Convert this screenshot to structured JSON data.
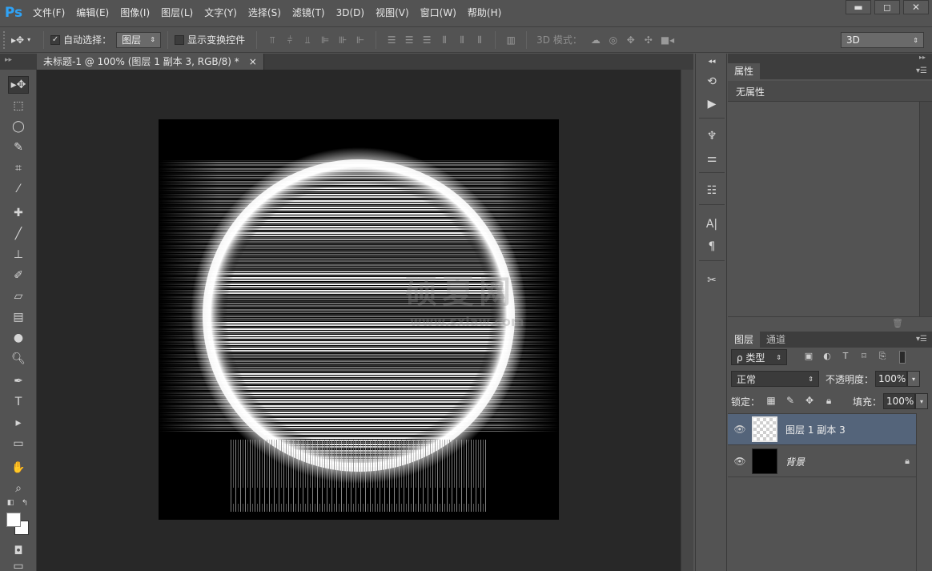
{
  "app": {
    "logo": "Ps"
  },
  "menu": [
    "文件(F)",
    "编辑(E)",
    "图像(I)",
    "图层(L)",
    "文字(Y)",
    "选择(S)",
    "滤镜(T)",
    "3D(D)",
    "视图(V)",
    "窗口(W)",
    "帮助(H)"
  ],
  "window_controls": {
    "minimize": "▬",
    "maximize": "◻",
    "close": "✕"
  },
  "options": {
    "tool_icon": "move-tool-icon",
    "auto_select_checked": true,
    "auto_select_label": "自动选择：",
    "auto_select_value": "图层",
    "show_transform_label": "显示变换控件",
    "show_transform_checked": false,
    "mode3d_label": "3D 模式：",
    "workspace": "3D"
  },
  "document": {
    "tab_title": "未标题-1 @ 100% (图层 1 副本 3, RGB/8) *",
    "tab_close": "×"
  },
  "watermark": {
    "text": "硕夏网",
    "sub": "www.sxiaw.com"
  },
  "properties": {
    "tab_label": "属性",
    "content": "无属性"
  },
  "layers_panel": {
    "tabs": [
      "图层",
      "通道"
    ],
    "filter_label": "ρ 类型",
    "blend_mode": "正常",
    "opacity_label": "不透明度：",
    "opacity_value": "100%",
    "lock_label": "锁定：",
    "fill_label": "填充：",
    "fill_value": "100%",
    "layers": [
      {
        "name": "图层 1 副本 3",
        "visible": true,
        "selected": true,
        "locked": false,
        "thumb": "transparent"
      },
      {
        "name": "背景",
        "visible": true,
        "selected": false,
        "locked": true,
        "thumb": "black"
      }
    ]
  },
  "colors": {
    "ui_bg": "#535353",
    "canvas_bg": "#282828",
    "selection": "#54647a",
    "ps_blue": "#2fa3f7"
  }
}
